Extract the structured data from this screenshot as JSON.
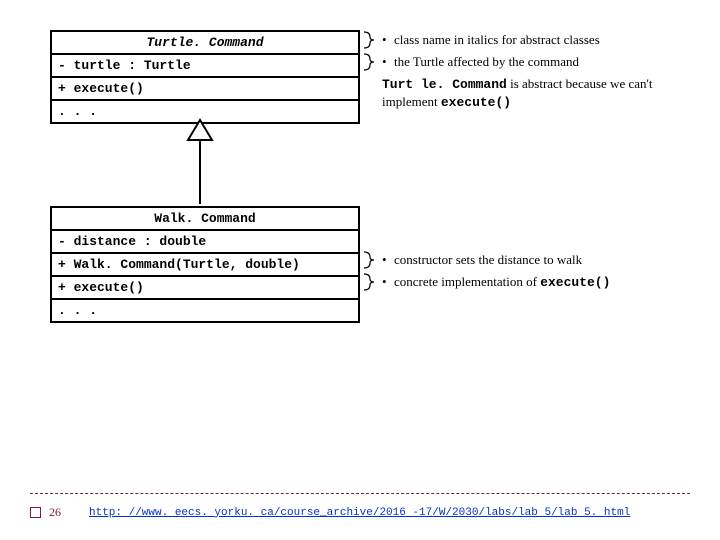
{
  "classes": {
    "parent": {
      "name": "Turtle. Command",
      "attr": "- turtle : Turtle",
      "op1": "+ execute()",
      "dots": ". . ."
    },
    "child": {
      "name": "Walk. Command",
      "attr": "- distance : double",
      "op1": "+ Walk. Command(Turtle, double)",
      "op2": "+ execute()",
      "dots": ". . ."
    }
  },
  "annotations": {
    "a1": "class name in italics for abstract classes",
    "a2": "the Turtle affected by the command",
    "a3_pre": "Turt le. Command",
    "a3_mid": " is abstract because we can't implement ",
    "a3_code": "execute()",
    "b1": "constructor sets the distance to walk",
    "b2_pre": "concrete implementation of ",
    "b2_code": "execute()"
  },
  "footer": {
    "page": "26",
    "link_text": "http: //www. eecs. yorku. ca/course_archive/2016 -17/W/2030/labs/lab 5/lab 5. html",
    "link_href": "#"
  }
}
